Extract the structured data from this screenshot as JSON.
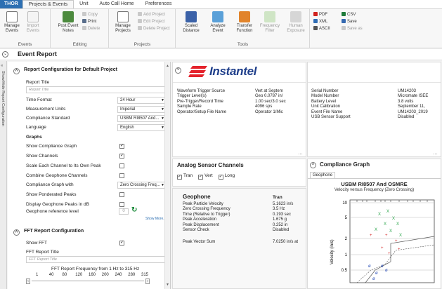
{
  "ribbon_tabs": [
    "THOR",
    "Projects & Events",
    "Unit",
    "Auto Call Home",
    "Preferences"
  ],
  "ribbon": {
    "groups": [
      "Events",
      "Editing",
      "Projects",
      "Tools"
    ],
    "manage_events": "Manage Events",
    "import_events": "Import Events",
    "post_event_notes": "Post Event Notes",
    "copy": "Copy",
    "print": "Print",
    "delete": "Delete",
    "manage_projects": "Manage Projects",
    "add_project": "Add Project",
    "edit_project": "Edit Project",
    "delete_project": "Delete Project",
    "scaled_distance": "Scaled Distance",
    "analyze_event": "Analyze Event",
    "transfer_function": "Transfer Function",
    "frequency_filter": "Frequency Filter",
    "human_exposure": "Human Exposure",
    "pdf": "PDF",
    "xml": "XML",
    "ascii": "ASCII",
    "csv": "CSV",
    "save": "Save",
    "save_as": "Save as"
  },
  "title": "Event Report",
  "sidebar_label": "Show/Hide Report Configuration",
  "report_config": {
    "header": "Report Configuration for Default Project",
    "report_title_label": "Report Title",
    "report_title_placeholder": "Report Title",
    "rows": [
      {
        "label": "Time Format",
        "value": "24 Hour"
      },
      {
        "label": "Measurement Units",
        "value": "Imperial"
      },
      {
        "label": "Compliance Standard",
        "value": "USBM RI8507 And..."
      },
      {
        "label": "Language",
        "value": "English"
      }
    ],
    "graphs_header": "Graphs",
    "graph_rows": [
      {
        "label": "Show Compliance Graph",
        "checked": true
      },
      {
        "label": "Show Channels",
        "checked": true
      },
      {
        "label": "Scale Each Channel to Its Own Peak",
        "checked": false
      },
      {
        "label": "Combine Geophone Channels",
        "checked": false
      },
      {
        "label": "Compliance Graph with",
        "dropdown": "Zero Crossing Freq..."
      },
      {
        "label": "Show Ponderated Peaks",
        "checked": false
      },
      {
        "label": "Display Geophone Peaks in dB",
        "checked": false
      },
      {
        "label": "Geophone reference level",
        "number": "0"
      }
    ],
    "show_more": "Show More..."
  },
  "fft_config": {
    "header": "FFT Report Configuration",
    "show_fft_label": "Show FFT",
    "fft_title_label": "FFT Report Title",
    "fft_title_placeholder": "FFT Report Title",
    "range_text": "FFT Report Frequency from 1 Hz to 315 Hz",
    "ticks": [
      "1",
      "40",
      "80",
      "120",
      "160",
      "200",
      "240",
      "280",
      "315"
    ]
  },
  "report": {
    "logo": "Instantel",
    "waveform": [
      {
        "k": "Waveform Trigger Source",
        "v": "Vert at Septem"
      },
      {
        "k": "Trigger Level(s)",
        "v": "Geo 0.0787 in/"
      },
      {
        "k": "Pre-Trigger/Record Time",
        "v": "1.00 sec/3.0 sec"
      },
      {
        "k": "Sample Rate",
        "v": "4096 sps"
      },
      {
        "k": "Operator/Setup File Name",
        "v": "Operator 1/Mic"
      }
    ],
    "unit_info": [
      {
        "k": "Serial Number",
        "v": "UM14203"
      },
      {
        "k": "Model Number",
        "v": "Micromate ISEE"
      },
      {
        "k": "Battery Level",
        "v": "3.8 volts"
      },
      {
        "k": "Unit Calibration",
        "v": "September 11,"
      },
      {
        "k": "Event File Name",
        "v": "UM14203_2019"
      },
      {
        "k": "USB Sensor Support",
        "v": "Disabled"
      }
    ],
    "analog_title": "Analog Sensor Channels",
    "analog_channels": [
      "Tran",
      "Vert",
      "Long"
    ],
    "geophone_title": "Geophone",
    "geophone_col": "Tran",
    "geophone_rows": [
      {
        "k": "Peak Particle Velocity",
        "v": "5.1623 in/s"
      },
      {
        "k": "Zero Crossing Frequency",
        "v": "3.5 Hz"
      },
      {
        "k": "Time (Relative to Trigger)",
        "v": "0.193 sec"
      },
      {
        "k": "Peak Acceleration",
        "v": "1.675 g"
      },
      {
        "k": "Peak Displacement",
        "v": "0.252 in"
      },
      {
        "k": "Sensor Check",
        "v": "Disabled"
      }
    ],
    "peak_vector_label": "Peak Vector Sum",
    "peak_vector_value": "7.0250 in/s at",
    "compliance_title": "Compliance Graph",
    "compliance_tab": "Geophone",
    "chart_title": "USBM RI8507 And OSMRE",
    "chart_subtitle": "Velocity versus Frequency (Zero Crossing)",
    "y_label": "Velocity (in/s)",
    "y_ticks": [
      "10",
      "5",
      "2",
      "1",
      "0.5"
    ],
    "marker_x": "X",
    "marker_plus": "+",
    "marker_o": "ø"
  },
  "colors": {
    "accent": "#2d6fb2",
    "logo": "#1e3e8a",
    "logo_mark": "#e4222b"
  }
}
